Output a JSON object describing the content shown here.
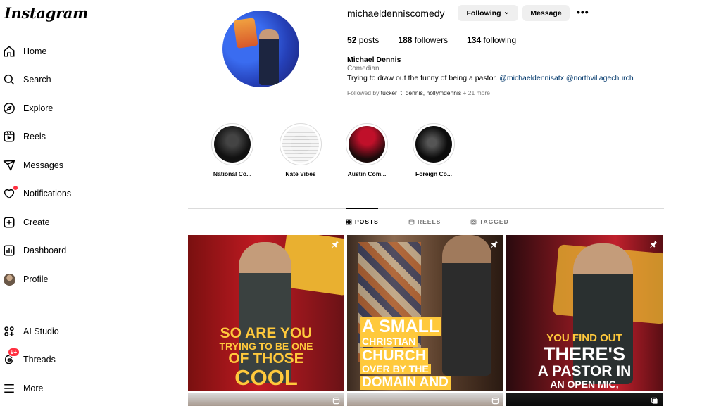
{
  "app": {
    "logo": "Instagram"
  },
  "sidebar": {
    "items": [
      {
        "label": "Home",
        "icon": "home-icon"
      },
      {
        "label": "Search",
        "icon": "search-icon"
      },
      {
        "label": "Explore",
        "icon": "compass-icon"
      },
      {
        "label": "Reels",
        "icon": "reels-icon"
      },
      {
        "label": "Messages",
        "icon": "paper-plane-icon"
      },
      {
        "label": "Notifications",
        "icon": "heart-icon"
      },
      {
        "label": "Create",
        "icon": "plus-square-icon"
      },
      {
        "label": "Dashboard",
        "icon": "bar-chart-icon"
      },
      {
        "label": "Profile",
        "icon": "avatar"
      },
      {
        "label": "AI Studio",
        "icon": "ai-studio-icon"
      },
      {
        "label": "Threads",
        "icon": "threads-icon",
        "badge": "9+"
      },
      {
        "label": "More",
        "icon": "menu-icon"
      }
    ]
  },
  "profile": {
    "username": "michaeldenniscomedy",
    "following_button": "Following",
    "message_button": "Message",
    "posts_count": "52",
    "posts_label": "posts",
    "followers_count": "188",
    "followers_label": "followers",
    "following_count": "134",
    "following_label": "following",
    "full_name": "Michael Dennis",
    "category": "Comedian",
    "bio_text": "Trying to draw out the funny of being a pastor.",
    "bio_mention_1": "@michaeldennisatx",
    "bio_mention_2": "@northvillagechurch",
    "followed_by_prefix": "Followed by",
    "followed_by_names": "tucker_t_dennis, hollymdennis",
    "followed_by_more": "+ 21 more"
  },
  "highlights": [
    {
      "label": "National Co..."
    },
    {
      "label": "Nate Vibes"
    },
    {
      "label": "Austin Com..."
    },
    {
      "label": "Foreign Co..."
    }
  ],
  "tabs": [
    {
      "label": "POSTS",
      "icon": "grid-icon"
    },
    {
      "label": "REELS",
      "icon": "reels-icon"
    },
    {
      "label": "TAGGED",
      "icon": "tagged-icon"
    }
  ],
  "posts": [
    {
      "caption": [
        "SO ARE YOU",
        "TRYING TO BE ONE",
        "OF THOSE",
        "COOL"
      ],
      "pinned": true
    },
    {
      "caption": [
        "A SMALL",
        "CHRISTIAN",
        "CHURCH",
        "OVER BY THE",
        "DOMAIN AND"
      ],
      "pinned": true
    },
    {
      "caption": [
        "YOU FIND OUT",
        "THERE'S",
        "A PASTOR IN",
        "AN OPEN MIC,"
      ],
      "pinned": true
    }
  ],
  "colors": {
    "accent": "#0095f6",
    "badge": "#ff3040",
    "caption_yellow": "#ffc93c",
    "link": "#00376b"
  }
}
